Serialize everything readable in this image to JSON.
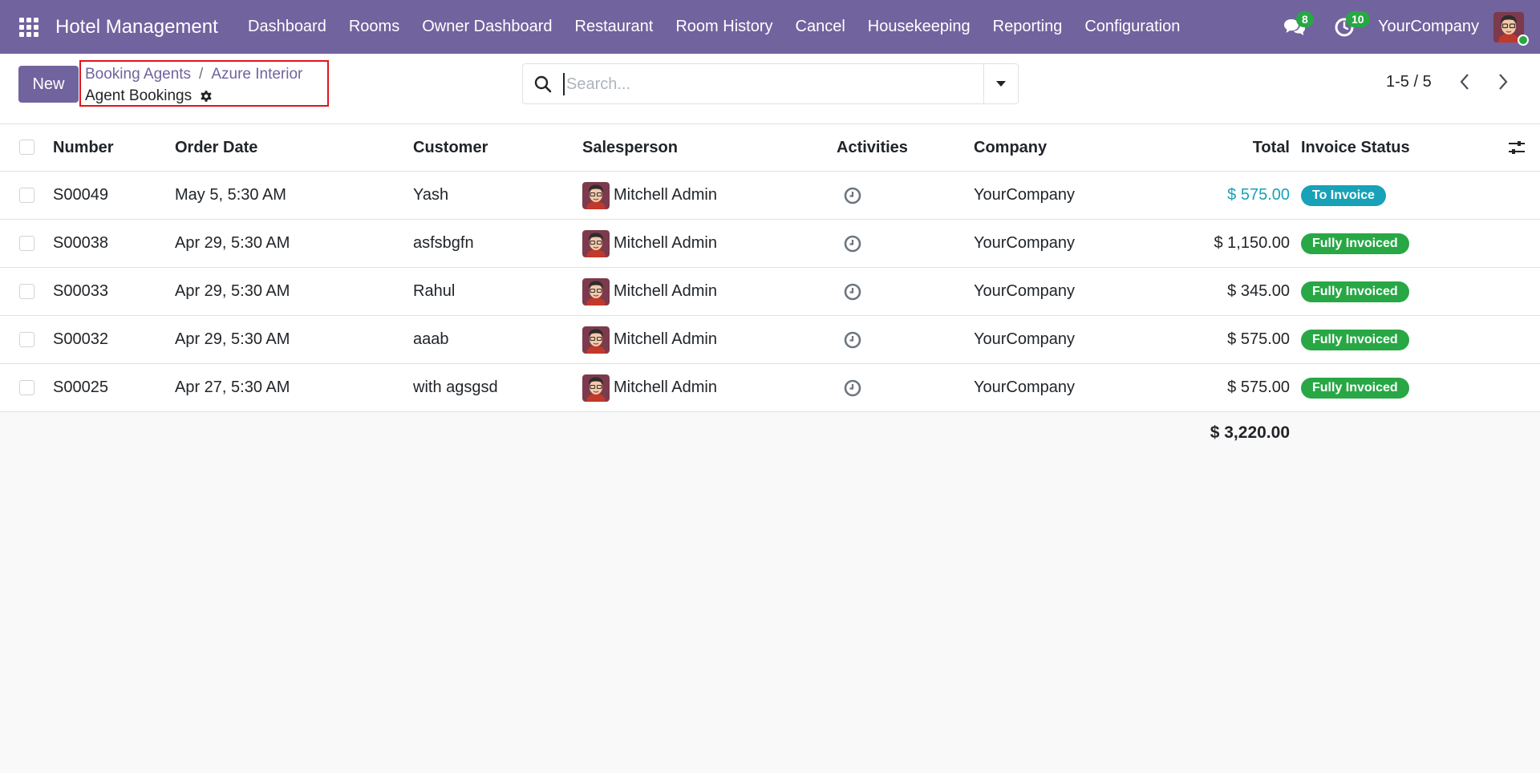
{
  "app": {
    "brand": "Hotel Management",
    "menu": [
      "Dashboard",
      "Rooms",
      "Owner Dashboard",
      "Restaurant",
      "Room History",
      "Cancel",
      "Housekeeping",
      "Reporting",
      "Configuration"
    ],
    "messages_count": "8",
    "activities_count": "10",
    "company": "YourCompany",
    "accent_color": "#71639e"
  },
  "control": {
    "new_label": "New",
    "breadcrumb": [
      "Booking Agents",
      "Azure Interior"
    ],
    "breadcrumb_separator": "/",
    "current": "Agent Bookings",
    "search_placeholder": "Search...",
    "pager": "1-5 / 5"
  },
  "table": {
    "columns": {
      "number": "Number",
      "order_date": "Order Date",
      "customer": "Customer",
      "salesperson": "Salesperson",
      "activities": "Activities",
      "company": "Company",
      "total": "Total",
      "invoice_status": "Invoice Status"
    },
    "rows": [
      {
        "number": "S00049",
        "date": "May 5, 5:30 AM",
        "customer": "Yash",
        "salesperson": "Mitchell Admin",
        "company": "YourCompany",
        "total": "$ 575.00",
        "status": "To Invoice",
        "status_color": "#17a2b8"
      },
      {
        "number": "S00038",
        "date": "Apr 29, 5:30 AM",
        "customer": "asfsbgfn",
        "salesperson": "Mitchell Admin",
        "company": "YourCompany",
        "total": "$ 1,150.00",
        "status": "Fully Invoiced",
        "status_color": "#28a745"
      },
      {
        "number": "S00033",
        "date": "Apr 29, 5:30 AM",
        "customer": "Rahul",
        "salesperson": "Mitchell Admin",
        "company": "YourCompany",
        "total": "$ 345.00",
        "status": "Fully Invoiced",
        "status_color": "#28a745"
      },
      {
        "number": "S00032",
        "date": "Apr 29, 5:30 AM",
        "customer": "aaab",
        "salesperson": "Mitchell Admin",
        "company": "YourCompany",
        "total": "$ 575.00",
        "status": "Fully Invoiced",
        "status_color": "#28a745"
      },
      {
        "number": "S00025",
        "date": "Apr 27, 5:30 AM",
        "customer": "with agsgsd",
        "salesperson": "Mitchell Admin",
        "company": "YourCompany",
        "total": "$ 575.00",
        "status": "Fully Invoiced",
        "status_color": "#28a745"
      }
    ],
    "grand_total": "$ 3,220.00"
  }
}
